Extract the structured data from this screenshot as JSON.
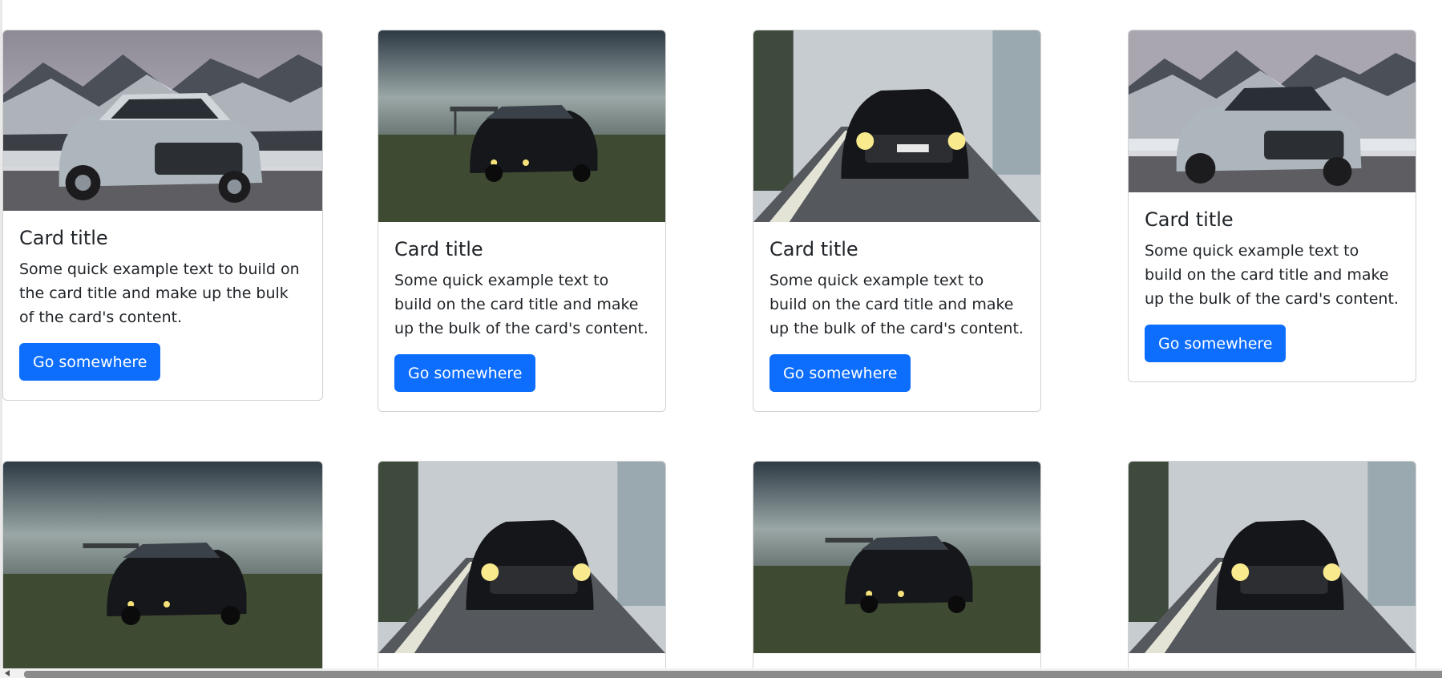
{
  "cards": [
    {
      "title": "Card title",
      "text": "Some quick example text to build on the card title and make up the bulk of the card's content.",
      "button": "Go somewhere",
      "image": "silver-suv-snowy-mountains"
    },
    {
      "title": "Card title",
      "text": "Some quick example text to build on the card title and make up the bulk of the card's content.",
      "button": "Go somewhere",
      "image": "black-suv-foggy-field"
    },
    {
      "title": "Card title",
      "text": "Some quick example text to build on the card title and make up the bulk of the card's content.",
      "button": "Go somewhere",
      "image": "black-suv-misty-forest-road"
    },
    {
      "title": "Card title",
      "text": "Some quick example text to build on the card title and make up the bulk of the card's content.",
      "button": "Go somewhere",
      "image": "silver-suv-snowy-mountains"
    },
    {
      "image": "black-suv-foggy-field"
    },
    {
      "image": "black-suv-misty-forest-road"
    },
    {
      "image": "black-suv-foggy-field"
    },
    {
      "image": "black-suv-misty-forest-road"
    }
  ],
  "colors": {
    "primary_button": "#0d6efd",
    "text": "#212529",
    "card_border": "#dcdcdc"
  }
}
